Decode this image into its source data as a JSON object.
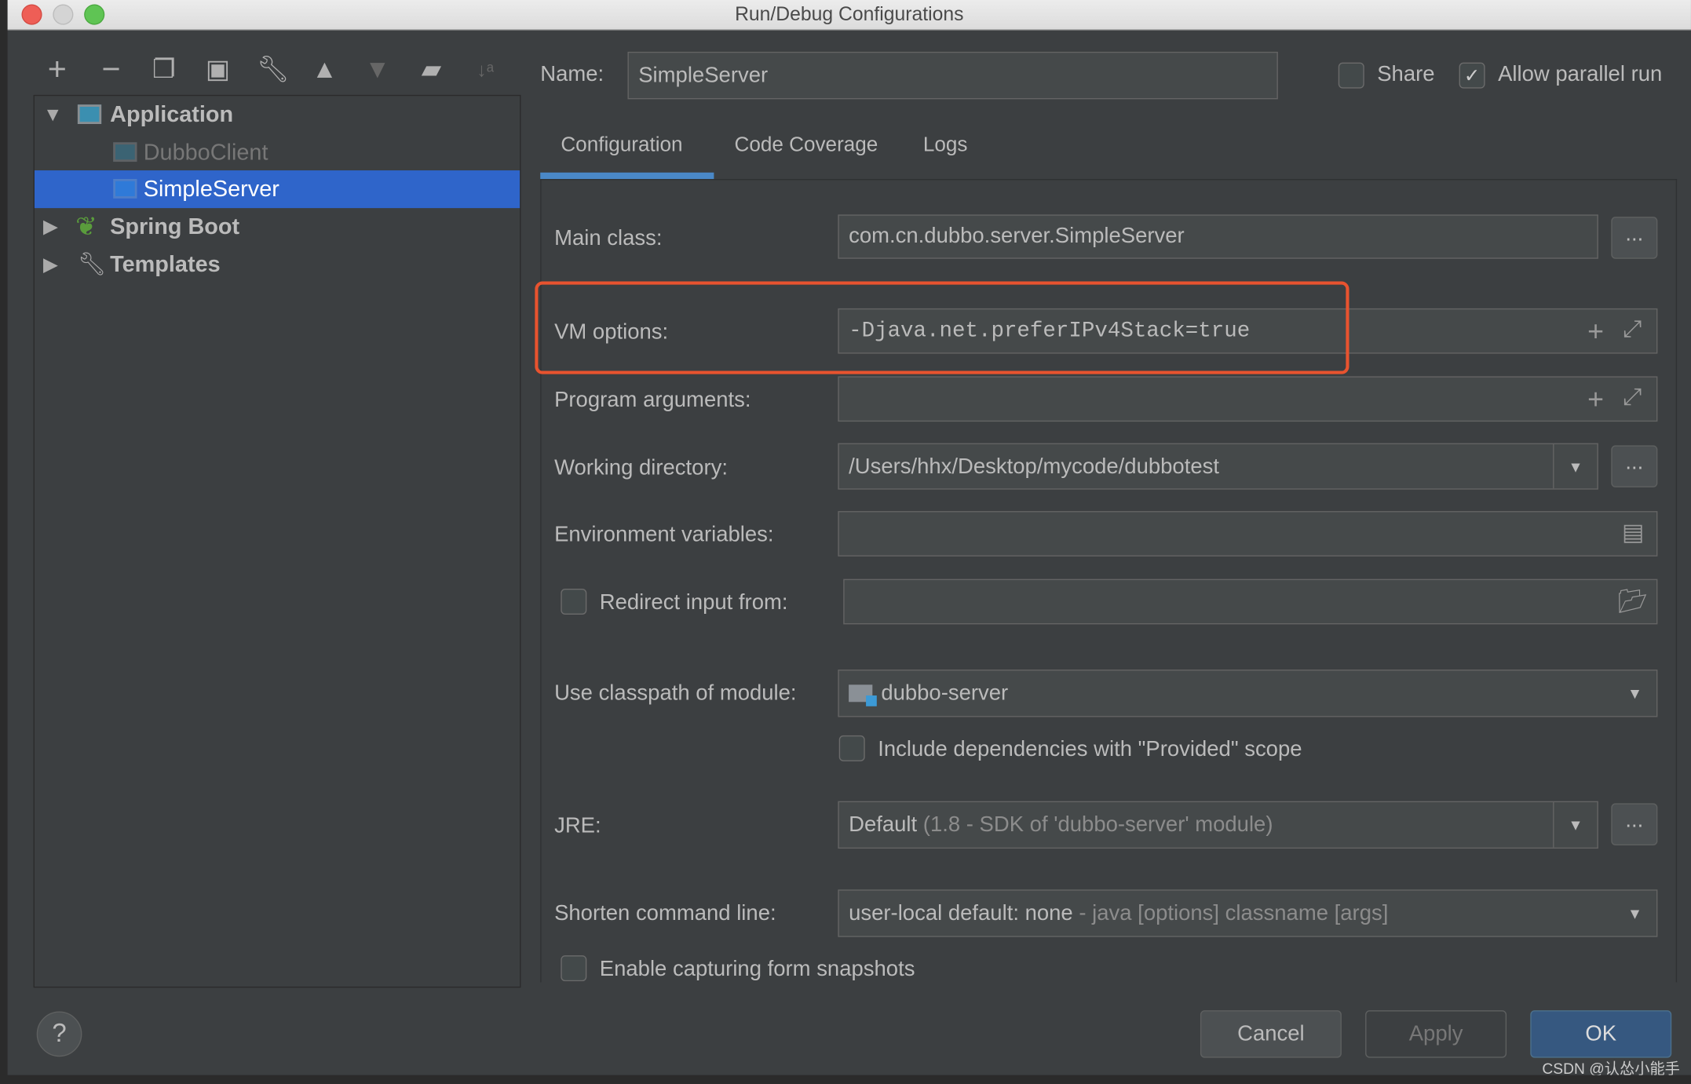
{
  "window": {
    "title": "Run/Debug Configurations"
  },
  "toolbar": {
    "icons": [
      "plus-icon",
      "minus-icon",
      "copy-icon",
      "save-icon",
      "wrench-icon",
      "arrow-up-icon",
      "arrow-down-icon",
      "folder-add-icon",
      "sort-az-icon"
    ]
  },
  "tree": {
    "items": [
      {
        "label": "Application",
        "expanded": true,
        "icon": "application-icon"
      },
      {
        "label": "DubboClient",
        "icon": "application-icon",
        "disabled": true
      },
      {
        "label": "SimpleServer",
        "icon": "application-icon",
        "selected": true
      },
      {
        "label": "Spring Boot",
        "expanded": false,
        "icon": "spring-boot-icon"
      },
      {
        "label": "Templates",
        "expanded": false,
        "icon": "wrench-icon"
      }
    ]
  },
  "header": {
    "name_label": "Name:",
    "name_value": "SimpleServer",
    "share_label": "Share",
    "share_checked": false,
    "parallel_label": "Allow parallel run",
    "parallel_checked": true
  },
  "tabs": [
    {
      "label": "Configuration",
      "active": true
    },
    {
      "label": "Code Coverage"
    },
    {
      "label": "Logs"
    }
  ],
  "form": {
    "main_class_label": "Main class:",
    "main_class_value": "com.cn.dubbo.server.SimpleServer",
    "vm_label": "VM options:",
    "vm_value": "-Djava.net.preferIPv4Stack=true",
    "program_args_label": "Program arguments:",
    "program_args_value": "",
    "working_dir_label": "Working directory:",
    "working_dir_value": "/Users/hhx/Desktop/mycode/dubbotest",
    "env_label": "Environment variables:",
    "env_value": "",
    "redirect_label": "Redirect input from:",
    "redirect_value": "",
    "classpath_label": "Use classpath of module:",
    "classpath_value": "dubbo-server",
    "include_deps_label": "Include dependencies with \"Provided\" scope",
    "jre_label": "JRE:",
    "jre_value": "Default",
    "jre_detail": "(1.8 - SDK of 'dubbo-server' module)",
    "shorten_label": "Shorten command line:",
    "shorten_value": "user-local default: none",
    "shorten_detail": "- java [options] classname [args]",
    "capture_label": "Enable capturing form snapshots",
    "browse_label": "..."
  },
  "buttons": {
    "help": "?",
    "cancel": "Cancel",
    "apply": "Apply",
    "ok": "OK"
  },
  "watermark": "CSDN @认怂小能手",
  "colors": {
    "selection": "#2f65ca",
    "highlight": "#e8532f",
    "ok": "#365880",
    "tab_underline": "#4a88c7"
  }
}
